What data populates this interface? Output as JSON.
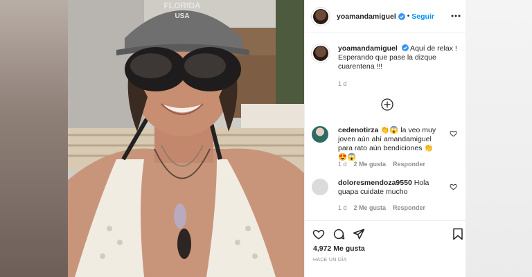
{
  "post": {
    "username": "yoamandamiguel",
    "follow_label": "Seguir",
    "dot": "•",
    "caption": "Aquí de relax ! Esperando que pase la dizque cuarentena !!!",
    "caption_time": "1 d",
    "hat_text_1": "FLORIDA",
    "hat_text_2": "USA"
  },
  "comments": [
    {
      "username": "cedenotirza",
      "text": "👏😱 la veo muy joven aún ahí amandamiguel para rato aún bendiciones 👏😍😱",
      "time": "1 d",
      "likes": "2 Me gusta",
      "reply": "Responder"
    },
    {
      "username": "doloresmendoza9550",
      "text": "Hola guapa cuidate mucho",
      "time": "1 d",
      "likes": "2 Me gusta",
      "reply": "Responder"
    }
  ],
  "footer": {
    "likes_count": "4,972 Me gusta",
    "posted": "HACE UN DÍA"
  },
  "icons": {
    "verified": "verified-badge-icon",
    "more": "more-options-icon",
    "add": "add-circle-icon",
    "heart": "heart-icon",
    "comment": "comment-icon",
    "share": "share-icon",
    "save": "bookmark-icon"
  },
  "colors": {
    "link": "#0095f6",
    "muted": "#8e8e8e",
    "text": "#262626"
  }
}
